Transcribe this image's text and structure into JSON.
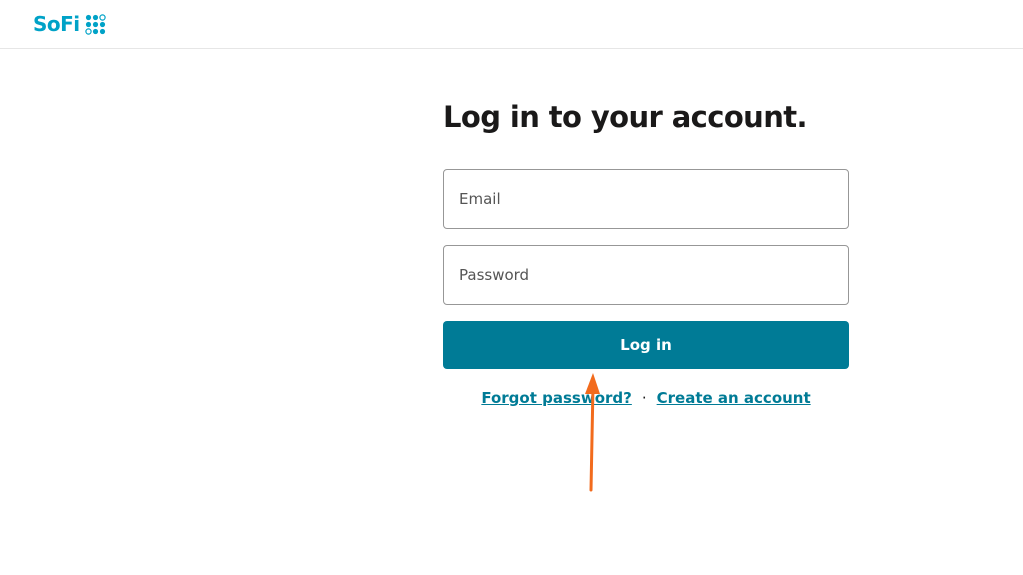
{
  "header": {
    "logo_text": "SoFi",
    "logo_icon": "sofi-dots-logo-mark",
    "brand_color": "#00a2c7"
  },
  "login": {
    "title": "Log in to your account.",
    "email_placeholder": "Email",
    "password_placeholder": "Password",
    "submit_label": "Log in",
    "forgot_password_label": "Forgot password?",
    "separator": "·",
    "create_account_label": "Create an account"
  },
  "colors": {
    "primary_button": "#007b96",
    "link": "#007b96",
    "annotation_arrow": "#f26b1d"
  }
}
